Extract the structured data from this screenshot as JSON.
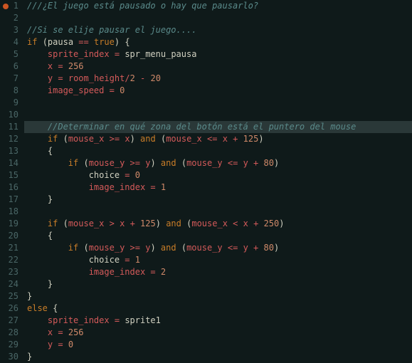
{
  "editor": {
    "highlighted_line": 11,
    "breakpoint_line": 1,
    "lines": [
      {
        "n": 1,
        "tokens": [
          [
            "comment",
            "///¿El juego está pausado o hay que pausarlo?"
          ]
        ]
      },
      {
        "n": 2,
        "tokens": []
      },
      {
        "n": 3,
        "tokens": [
          [
            "comment",
            "//Si se elije pausar el juego...."
          ]
        ]
      },
      {
        "n": 4,
        "tokens": [
          [
            "kw",
            "if"
          ],
          [
            "sp",
            " "
          ],
          [
            "paren",
            "("
          ],
          [
            "ident",
            "pausa"
          ],
          [
            "sp",
            " "
          ],
          [
            "op",
            "=="
          ],
          [
            "sp",
            " "
          ],
          [
            "kw",
            "true"
          ],
          [
            "paren",
            ")"
          ],
          [
            "sp",
            " "
          ],
          [
            "brace",
            "{"
          ]
        ]
      },
      {
        "n": 5,
        "tokens": [
          [
            "sp",
            "    "
          ],
          [
            "var",
            "sprite_index"
          ],
          [
            "sp",
            " "
          ],
          [
            "op",
            "="
          ],
          [
            "sp",
            " "
          ],
          [
            "ident",
            "spr_menu_pausa"
          ]
        ]
      },
      {
        "n": 6,
        "tokens": [
          [
            "sp",
            "    "
          ],
          [
            "var",
            "x"
          ],
          [
            "sp",
            " "
          ],
          [
            "op",
            "="
          ],
          [
            "sp",
            " "
          ],
          [
            "num",
            "256"
          ]
        ]
      },
      {
        "n": 7,
        "tokens": [
          [
            "sp",
            "    "
          ],
          [
            "var",
            "y"
          ],
          [
            "sp",
            " "
          ],
          [
            "op",
            "="
          ],
          [
            "sp",
            " "
          ],
          [
            "var",
            "room_height"
          ],
          [
            "op",
            "/"
          ],
          [
            "num",
            "2"
          ],
          [
            "sp",
            " "
          ],
          [
            "op",
            "-"
          ],
          [
            "sp",
            " "
          ],
          [
            "num",
            "20"
          ]
        ]
      },
      {
        "n": 8,
        "tokens": [
          [
            "sp",
            "    "
          ],
          [
            "var",
            "image_speed"
          ],
          [
            "sp",
            " "
          ],
          [
            "op",
            "="
          ],
          [
            "sp",
            " "
          ],
          [
            "num",
            "0"
          ]
        ]
      },
      {
        "n": 9,
        "tokens": []
      },
      {
        "n": 10,
        "tokens": []
      },
      {
        "n": 11,
        "tokens": [
          [
            "sp",
            "    "
          ],
          [
            "comment",
            "//Determinar en qué zona del botón está el puntero del mouse"
          ]
        ]
      },
      {
        "n": 12,
        "tokens": [
          [
            "sp",
            "    "
          ],
          [
            "kw",
            "if"
          ],
          [
            "sp",
            " "
          ],
          [
            "paren",
            "("
          ],
          [
            "var",
            "mouse_x"
          ],
          [
            "sp",
            " "
          ],
          [
            "op",
            ">="
          ],
          [
            "sp",
            " "
          ],
          [
            "var",
            "x"
          ],
          [
            "paren",
            ")"
          ],
          [
            "sp",
            " "
          ],
          [
            "kw",
            "and"
          ],
          [
            "sp",
            " "
          ],
          [
            "paren",
            "("
          ],
          [
            "var",
            "mouse_x"
          ],
          [
            "sp",
            " "
          ],
          [
            "op",
            "<="
          ],
          [
            "sp",
            " "
          ],
          [
            "var",
            "x"
          ],
          [
            "sp",
            " "
          ],
          [
            "op",
            "+"
          ],
          [
            "sp",
            " "
          ],
          [
            "num",
            "125"
          ],
          [
            "paren",
            ")"
          ]
        ]
      },
      {
        "n": 13,
        "tokens": [
          [
            "sp",
            "    "
          ],
          [
            "brace",
            "{"
          ]
        ]
      },
      {
        "n": 14,
        "tokens": [
          [
            "sp",
            "        "
          ],
          [
            "kw",
            "if"
          ],
          [
            "sp",
            " "
          ],
          [
            "paren",
            "("
          ],
          [
            "var",
            "mouse_y"
          ],
          [
            "sp",
            " "
          ],
          [
            "op",
            ">="
          ],
          [
            "sp",
            " "
          ],
          [
            "var",
            "y"
          ],
          [
            "paren",
            ")"
          ],
          [
            "sp",
            " "
          ],
          [
            "kw",
            "and"
          ],
          [
            "sp",
            " "
          ],
          [
            "paren",
            "("
          ],
          [
            "var",
            "mouse_y"
          ],
          [
            "sp",
            " "
          ],
          [
            "op",
            "<="
          ],
          [
            "sp",
            " "
          ],
          [
            "var",
            "y"
          ],
          [
            "sp",
            " "
          ],
          [
            "op",
            "+"
          ],
          [
            "sp",
            " "
          ],
          [
            "num",
            "80"
          ],
          [
            "paren",
            ")"
          ]
        ]
      },
      {
        "n": 15,
        "tokens": [
          [
            "sp",
            "            "
          ],
          [
            "ident",
            "choice"
          ],
          [
            "sp",
            " "
          ],
          [
            "op",
            "="
          ],
          [
            "sp",
            " "
          ],
          [
            "num",
            "0"
          ]
        ]
      },
      {
        "n": 16,
        "tokens": [
          [
            "sp",
            "            "
          ],
          [
            "var",
            "image_index"
          ],
          [
            "sp",
            " "
          ],
          [
            "op",
            "="
          ],
          [
            "sp",
            " "
          ],
          [
            "num",
            "1"
          ]
        ]
      },
      {
        "n": 17,
        "tokens": [
          [
            "sp",
            "    "
          ],
          [
            "brace",
            "}"
          ]
        ]
      },
      {
        "n": 18,
        "tokens": []
      },
      {
        "n": 19,
        "tokens": [
          [
            "sp",
            "    "
          ],
          [
            "kw",
            "if"
          ],
          [
            "sp",
            " "
          ],
          [
            "paren",
            "("
          ],
          [
            "var",
            "mouse_x"
          ],
          [
            "sp",
            " "
          ],
          [
            "op",
            ">"
          ],
          [
            "sp",
            " "
          ],
          [
            "var",
            "x"
          ],
          [
            "sp",
            " "
          ],
          [
            "op",
            "+"
          ],
          [
            "sp",
            " "
          ],
          [
            "num",
            "125"
          ],
          [
            "paren",
            ")"
          ],
          [
            "sp",
            " "
          ],
          [
            "kw",
            "and"
          ],
          [
            "sp",
            " "
          ],
          [
            "paren",
            "("
          ],
          [
            "var",
            "mouse_x"
          ],
          [
            "sp",
            " "
          ],
          [
            "op",
            "<"
          ],
          [
            "sp",
            " "
          ],
          [
            "var",
            "x"
          ],
          [
            "sp",
            " "
          ],
          [
            "op",
            "+"
          ],
          [
            "sp",
            " "
          ],
          [
            "num",
            "250"
          ],
          [
            "paren",
            ")"
          ]
        ]
      },
      {
        "n": 20,
        "tokens": [
          [
            "sp",
            "    "
          ],
          [
            "brace",
            "{"
          ]
        ]
      },
      {
        "n": 21,
        "tokens": [
          [
            "sp",
            "        "
          ],
          [
            "kw",
            "if"
          ],
          [
            "sp",
            " "
          ],
          [
            "paren",
            "("
          ],
          [
            "var",
            "mouse_y"
          ],
          [
            "sp",
            " "
          ],
          [
            "op",
            ">="
          ],
          [
            "sp",
            " "
          ],
          [
            "var",
            "y"
          ],
          [
            "paren",
            ")"
          ],
          [
            "sp",
            " "
          ],
          [
            "kw",
            "and"
          ],
          [
            "sp",
            " "
          ],
          [
            "paren",
            "("
          ],
          [
            "var",
            "mouse_y"
          ],
          [
            "sp",
            " "
          ],
          [
            "op",
            "<="
          ],
          [
            "sp",
            " "
          ],
          [
            "var",
            "y"
          ],
          [
            "sp",
            " "
          ],
          [
            "op",
            "+"
          ],
          [
            "sp",
            " "
          ],
          [
            "num",
            "80"
          ],
          [
            "paren",
            ")"
          ]
        ]
      },
      {
        "n": 22,
        "tokens": [
          [
            "sp",
            "            "
          ],
          [
            "ident",
            "choice"
          ],
          [
            "sp",
            " "
          ],
          [
            "op",
            "="
          ],
          [
            "sp",
            " "
          ],
          [
            "num",
            "1"
          ]
        ]
      },
      {
        "n": 23,
        "tokens": [
          [
            "sp",
            "            "
          ],
          [
            "var",
            "image_index"
          ],
          [
            "sp",
            " "
          ],
          [
            "op",
            "="
          ],
          [
            "sp",
            " "
          ],
          [
            "num",
            "2"
          ]
        ]
      },
      {
        "n": 24,
        "tokens": [
          [
            "sp",
            "    "
          ],
          [
            "brace",
            "}"
          ]
        ]
      },
      {
        "n": 25,
        "tokens": [
          [
            "brace",
            "}"
          ]
        ]
      },
      {
        "n": 26,
        "tokens": [
          [
            "kw",
            "else"
          ],
          [
            "sp",
            " "
          ],
          [
            "brace",
            "{"
          ]
        ]
      },
      {
        "n": 27,
        "tokens": [
          [
            "sp",
            "    "
          ],
          [
            "var",
            "sprite_index"
          ],
          [
            "sp",
            " "
          ],
          [
            "op",
            "="
          ],
          [
            "sp",
            " "
          ],
          [
            "ident",
            "sprite1"
          ]
        ]
      },
      {
        "n": 28,
        "tokens": [
          [
            "sp",
            "    "
          ],
          [
            "var",
            "x"
          ],
          [
            "sp",
            " "
          ],
          [
            "op",
            "="
          ],
          [
            "sp",
            " "
          ],
          [
            "num",
            "256"
          ]
        ]
      },
      {
        "n": 29,
        "tokens": [
          [
            "sp",
            "    "
          ],
          [
            "var",
            "y"
          ],
          [
            "sp",
            " "
          ],
          [
            "op",
            "="
          ],
          [
            "sp",
            " "
          ],
          [
            "num",
            "0"
          ]
        ]
      },
      {
        "n": 30,
        "tokens": [
          [
            "brace",
            "}"
          ]
        ]
      }
    ]
  }
}
